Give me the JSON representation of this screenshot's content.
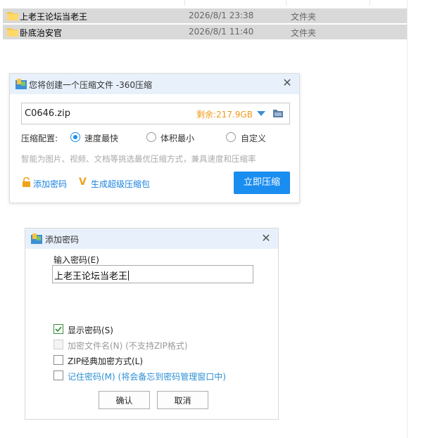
{
  "file_list": {
    "rows": [
      {
        "name": "上老王论坛当老王",
        "date": "2026/8/1 23:38",
        "type": "文件夹"
      },
      {
        "name": "卧底治安官",
        "date": "2026/8/1 11:40",
        "type": "文件夹"
      }
    ]
  },
  "compress_dialog": {
    "title": "您将创建一个压缩文件 -360压缩",
    "filename": "C0646.zip",
    "free_space": "剩余:217.9GB",
    "config_label": "压缩配置:",
    "options": [
      {
        "label": "速度最快",
        "selected": true
      },
      {
        "label": "体积最小",
        "selected": false
      },
      {
        "label": "自定义",
        "selected": false
      }
    ],
    "hint": "智能为图片、视频、文档等挑选最优压缩方式，兼具速度和压缩率",
    "add_password_label": "添加密码",
    "super_package_label": "生成超级压缩包",
    "compress_button": "立即压缩",
    "accent_color": "#1a8df0",
    "space_color": "#f09a1a"
  },
  "password_dialog": {
    "title": "添加密码",
    "input_label": "输入密码(E)",
    "input_value": "上老王论坛当老王",
    "options": [
      {
        "label": "显示密码(S)",
        "checked": true,
        "enabled": true
      },
      {
        "label": "加密文件名(N) (不支持ZIP格式)",
        "checked": false,
        "enabled": false
      },
      {
        "label": "ZIP经典加密方式(L)",
        "checked": false,
        "enabled": true
      },
      {
        "label": "记住密码(M) (将会备忘到密码管理窗口中)",
        "checked": false,
        "enabled": true
      }
    ],
    "ok_button": "确认",
    "cancel_button": "取消"
  }
}
